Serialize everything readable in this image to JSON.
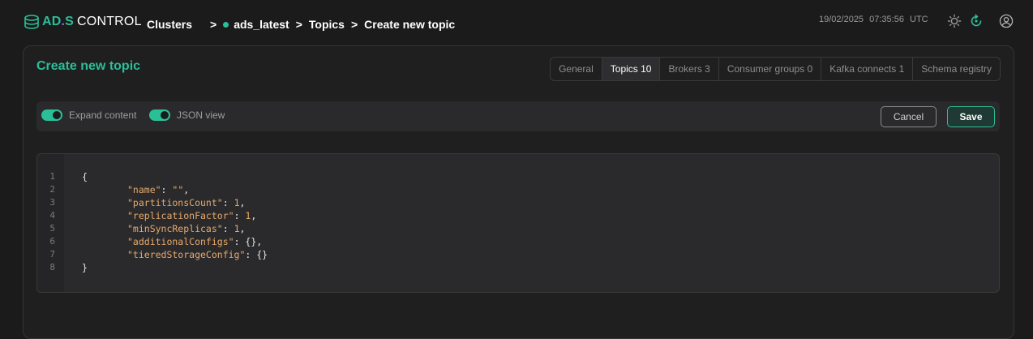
{
  "header": {
    "logo": {
      "ads": "AD",
      "dot": ".",
      "s": "S",
      "control": "CONTROL"
    },
    "breadcrumb": {
      "clusters": "Clusters",
      "sep1": ">",
      "cluster": "ads_latest",
      "sep2": ">",
      "topics": "Topics",
      "sep3": ">",
      "current": "Create new topic"
    },
    "date": "19/02/2025",
    "time": "07:35:56",
    "timezone": "UTC",
    "icons": [
      "sun-icon",
      "refresh-icon",
      "user-icon"
    ]
  },
  "page": {
    "title": "Create new topic",
    "tabs": [
      {
        "label": "General"
      },
      {
        "label": "Topics 10",
        "active": true
      },
      {
        "label": "Brokers 3"
      },
      {
        "label": "Consumer groups 0"
      },
      {
        "label": "Kafka connects 1"
      },
      {
        "label": "Schema registry"
      }
    ],
    "toolbar": {
      "expand_label": "Expand content",
      "json_label": "JSON view",
      "cancel_label": "Cancel",
      "save_label": "Save"
    },
    "editor": {
      "lines": [
        {
          "no": "1",
          "text": "{"
        },
        {
          "no": "2",
          "key": "\"name\"",
          "sep": ": ",
          "val": "\"\"",
          "end": ","
        },
        {
          "no": "3",
          "key": "\"partitionsCount\"",
          "sep": ": ",
          "val": "1",
          "end": ","
        },
        {
          "no": "4",
          "key": "\"replicationFactor\"",
          "sep": ": ",
          "val": "1",
          "end": ","
        },
        {
          "no": "5",
          "key": "\"minSyncReplicas\"",
          "sep": ": ",
          "val": "1",
          "end": ","
        },
        {
          "no": "6",
          "key": "\"additionalConfigs\"",
          "sep": ": {},",
          "val": "",
          "end": ""
        },
        {
          "no": "7",
          "key": "\"tieredStorageConfig\"",
          "sep": ": {}",
          "val": "",
          "end": ""
        },
        {
          "no": "8",
          "text": "}"
        }
      ]
    }
  },
  "colors": {
    "accent": "#2bbf98",
    "dot": "#9a5cf0",
    "json_key": "#e6a96b"
  }
}
